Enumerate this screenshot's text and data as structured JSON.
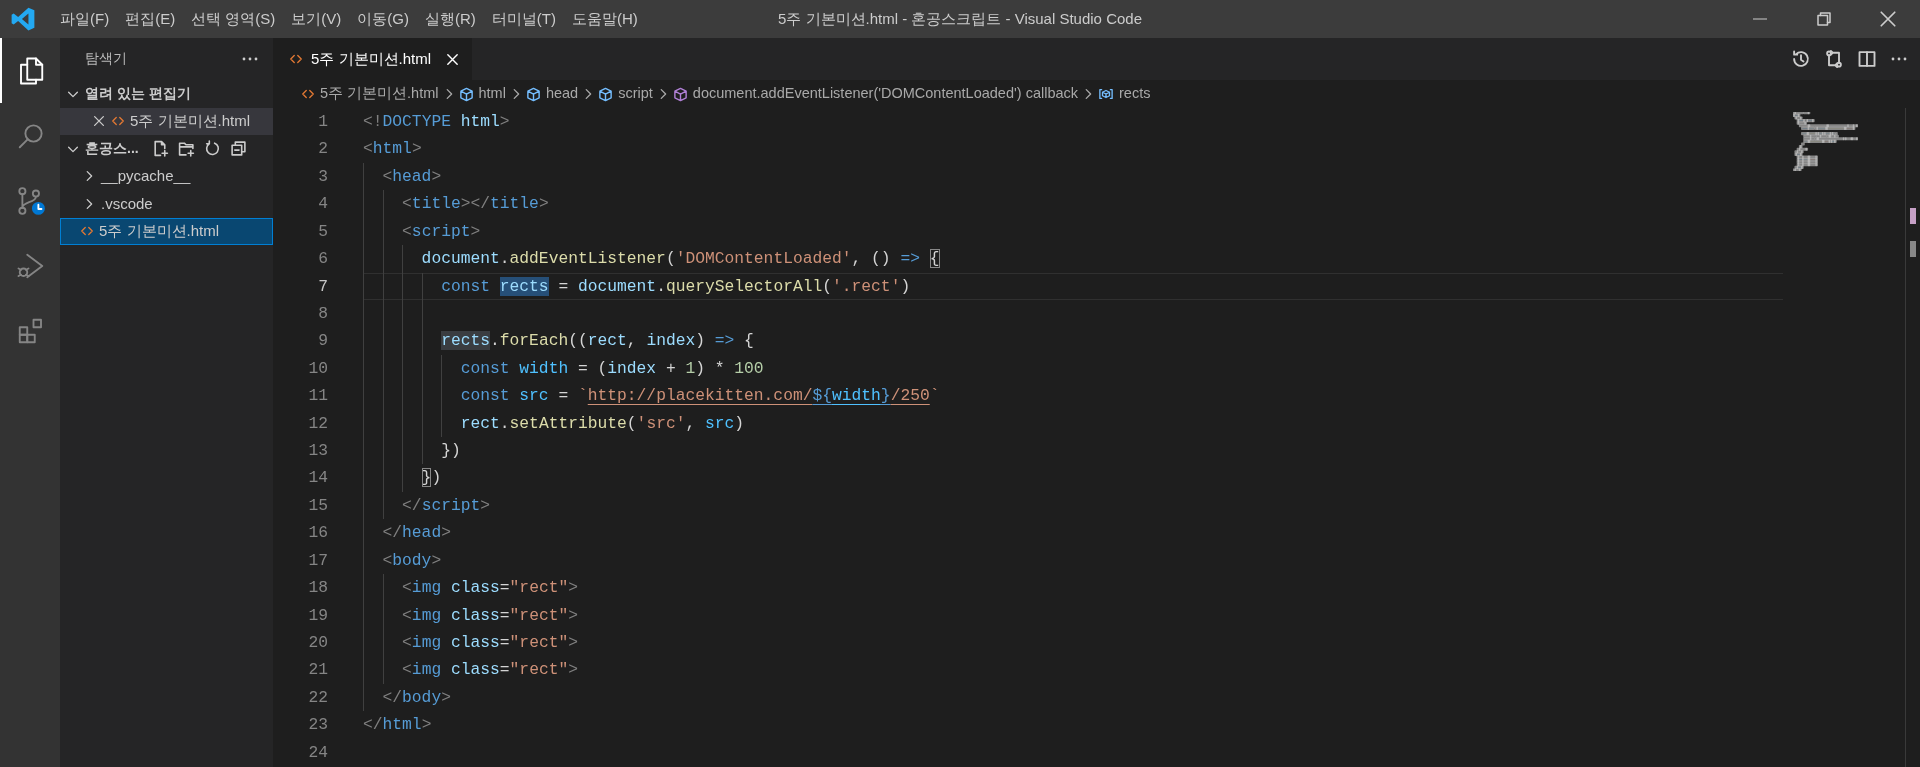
{
  "title_bar": {
    "menu": [
      "파일(F)",
      "편집(E)",
      "선택 영역(S)",
      "보기(V)",
      "이동(G)",
      "실행(R)",
      "터미널(T)",
      "도움말(H)"
    ],
    "title": "5주 기본미션.html - 혼공스크립트 - Visual Studio Code"
  },
  "activity_bar": [
    {
      "kind": "explorer",
      "selected": true
    },
    {
      "kind": "search",
      "selected": false
    },
    {
      "kind": "source_control",
      "selected": false
    },
    {
      "kind": "run",
      "selected": false
    },
    {
      "kind": "extensions",
      "selected": false
    }
  ],
  "sidebar": {
    "title": "탐색기",
    "sections": [
      {
        "kind": "open_editors",
        "title": "열려 있는 편집기",
        "expanded": true,
        "items": [
          {
            "label": "5주 기본미션.html",
            "kind": "html",
            "active": true
          }
        ]
      },
      {
        "kind": "folder",
        "title": "혼공스...",
        "expanded": true,
        "items": [
          {
            "label": "__pycache__",
            "kind": "folder",
            "expanded": false,
            "selected": false
          },
          {
            "label": ".vscode",
            "kind": "folder",
            "expanded": false,
            "selected": false
          },
          {
            "label": "5주 기본미션.html",
            "kind": "html",
            "selected": true
          }
        ]
      }
    ]
  },
  "editor": {
    "tabs": [
      {
        "label": "5주 기본미션.html",
        "selected": true
      }
    ],
    "breadcrumbs": [
      {
        "label": "5주 기본미션.html",
        "kind": "file"
      },
      {
        "label": "html",
        "kind": "element"
      },
      {
        "label": "head",
        "kind": "element"
      },
      {
        "label": "script",
        "kind": "element"
      },
      {
        "label": "document.addEventListener('DOMContentLoaded') callback",
        "kind": "function"
      },
      {
        "label": "rects",
        "kind": "variable"
      }
    ],
    "lines": [
      {
        "number": "1",
        "current": false,
        "tokens": [
          {
            "text": "<!",
            "kind": "bracket"
          },
          {
            "text": "DOCTYPE",
            "kind": "tag"
          },
          {
            "text": " html",
            "kind": "attribute"
          },
          {
            "text": ">",
            "kind": "bracket"
          }
        ]
      },
      {
        "number": "2",
        "current": false,
        "tokens": [
          {
            "text": "<",
            "kind": "bracket"
          },
          {
            "text": "html",
            "kind": "tag"
          },
          {
            "text": ">",
            "kind": "bracket"
          }
        ]
      },
      {
        "number": "3",
        "current": false,
        "tokens": [
          {
            "text": "  <",
            "kind": "bracket"
          },
          {
            "text": "head",
            "kind": "tag"
          },
          {
            "text": ">",
            "kind": "bracket"
          }
        ]
      },
      {
        "number": "4",
        "current": false,
        "tokens": [
          {
            "text": "    <",
            "kind": "bracket"
          },
          {
            "text": "title",
            "kind": "tag"
          },
          {
            "text": "></",
            "kind": "bracket"
          },
          {
            "text": "title",
            "kind": "tag"
          },
          {
            "text": ">",
            "kind": "bracket"
          }
        ]
      },
      {
        "number": "5",
        "current": false,
        "tokens": [
          {
            "text": "    <",
            "kind": "bracket"
          },
          {
            "text": "script",
            "kind": "tag"
          },
          {
            "text": ">",
            "kind": "bracket"
          }
        ]
      },
      {
        "number": "6",
        "current": false,
        "tokens": [
          {
            "text": "      document",
            "kind": "variable"
          },
          {
            "text": ".",
            "kind": "plain"
          },
          {
            "text": "addEventListener",
            "kind": "function"
          },
          {
            "text": "(",
            "kind": "plain"
          },
          {
            "text": "'DOMContentLoaded'",
            "kind": "string"
          },
          {
            "text": ", () ",
            "kind": "plain"
          },
          {
            "text": "=> ",
            "kind": "keyword"
          },
          {
            "text": "{",
            "kind": "plain",
            "bracket_match": true
          }
        ]
      },
      {
        "number": "7",
        "current": true,
        "tokens": [
          {
            "text": "        const ",
            "kind": "keyword"
          },
          {
            "text": "rects",
            "kind": "variable",
            "selected": true
          },
          {
            "text": " = ",
            "kind": "plain"
          },
          {
            "text": "document",
            "kind": "variable"
          },
          {
            "text": ".",
            "kind": "plain"
          },
          {
            "text": "querySelectorAll",
            "kind": "function"
          },
          {
            "text": "(",
            "kind": "plain"
          },
          {
            "text": "'.rect'",
            "kind": "string"
          },
          {
            "text": ")",
            "kind": "plain"
          }
        ]
      },
      {
        "number": "8",
        "current": false
      },
      {
        "number": "9",
        "current": false,
        "tokens": [
          {
            "text": "        rects",
            "kind": "variable",
            "occurrence": true
          },
          {
            "text": ".",
            "kind": "plain"
          },
          {
            "text": "forEach",
            "kind": "function"
          },
          {
            "text": "((",
            "kind": "plain"
          },
          {
            "text": "rect",
            "kind": "variable"
          },
          {
            "text": ", ",
            "kind": "plain"
          },
          {
            "text": "index",
            "kind": "variable"
          },
          {
            "text": ") ",
            "kind": "plain"
          },
          {
            "text": "=>",
            "kind": "keyword"
          },
          {
            "text": " {",
            "kind": "plain"
          }
        ]
      },
      {
        "number": "10",
        "current": false,
        "tokens": [
          {
            "text": "          const ",
            "kind": "keyword"
          },
          {
            "text": "width",
            "kind": "constant"
          },
          {
            "text": " = (",
            "kind": "plain"
          },
          {
            "text": "index",
            "kind": "variable"
          },
          {
            "text": " + ",
            "kind": "plain"
          },
          {
            "text": "1",
            "kind": "number"
          },
          {
            "text": ") * ",
            "kind": "plain"
          },
          {
            "text": "100",
            "kind": "number"
          }
        ]
      },
      {
        "number": "11",
        "current": false,
        "tokens": [
          {
            "text": "          const ",
            "kind": "keyword"
          },
          {
            "text": "src",
            "kind": "constant"
          },
          {
            "text": " = ",
            "kind": "plain"
          },
          {
            "text": "`",
            "kind": "string"
          },
          {
            "text": "http://placekitten.com/",
            "kind": "string",
            "link": true
          },
          {
            "text": "${",
            "kind": "keyword",
            "link": true
          },
          {
            "text": "width",
            "kind": "constant",
            "link": true
          },
          {
            "text": "}",
            "kind": "keyword",
            "link": true
          },
          {
            "text": "/250",
            "kind": "string",
            "link": true
          },
          {
            "text": "`",
            "kind": "string"
          }
        ]
      },
      {
        "number": "12",
        "current": false,
        "tokens": [
          {
            "text": "          rect",
            "kind": "variable"
          },
          {
            "text": ".",
            "kind": "plain"
          },
          {
            "text": "setAttribute",
            "kind": "function"
          },
          {
            "text": "(",
            "kind": "plain"
          },
          {
            "text": "'src'",
            "kind": "string"
          },
          {
            "text": ", ",
            "kind": "plain"
          },
          {
            "text": "src",
            "kind": "constant"
          },
          {
            "text": ")",
            "kind": "plain"
          }
        ]
      },
      {
        "number": "13",
        "current": false,
        "tokens": [
          {
            "text": "        })",
            "kind": "plain"
          }
        ]
      },
      {
        "number": "14",
        "current": false,
        "tokens": [
          {
            "text": "      }",
            "kind": "plain",
            "bracket_match": true
          },
          {
            "text": ")",
            "kind": "plain"
          }
        ]
      },
      {
        "number": "15",
        "current": false,
        "tokens": [
          {
            "text": "    </",
            "kind": "bracket"
          },
          {
            "text": "script",
            "kind": "tag"
          },
          {
            "text": ">",
            "kind": "bracket"
          }
        ]
      },
      {
        "number": "16",
        "current": false,
        "tokens": [
          {
            "text": "  </",
            "kind": "bracket"
          },
          {
            "text": "head",
            "kind": "tag"
          },
          {
            "text": ">",
            "kind": "bracket"
          }
        ]
      },
      {
        "number": "17",
        "current": false,
        "tokens": [
          {
            "text": "  <",
            "kind": "bracket"
          },
          {
            "text": "body",
            "kind": "tag"
          },
          {
            "text": ">",
            "kind": "bracket"
          }
        ]
      },
      {
        "number": "18",
        "current": false,
        "tokens": [
          {
            "text": "    <",
            "kind": "bracket"
          },
          {
            "text": "img ",
            "kind": "tag"
          },
          {
            "text": "class",
            "kind": "attribute"
          },
          {
            "text": "=",
            "kind": "plain"
          },
          {
            "text": "\"rect\"",
            "kind": "string"
          },
          {
            "text": ">",
            "kind": "bracket"
          }
        ]
      },
      {
        "number": "19",
        "current": false,
        "tokens": [
          {
            "text": "    <",
            "kind": "bracket"
          },
          {
            "text": "img ",
            "kind": "tag"
          },
          {
            "text": "class",
            "kind": "attribute"
          },
          {
            "text": "=",
            "kind": "plain"
          },
          {
            "text": "\"rect\"",
            "kind": "string"
          },
          {
            "text": ">",
            "kind": "bracket"
          }
        ]
      },
      {
        "number": "20",
        "current": false,
        "tokens": [
          {
            "text": "    <",
            "kind": "bracket"
          },
          {
            "text": "img ",
            "kind": "tag"
          },
          {
            "text": "class",
            "kind": "attribute"
          },
          {
            "text": "=",
            "kind": "plain"
          },
          {
            "text": "\"rect\"",
            "kind": "string"
          },
          {
            "text": ">",
            "kind": "bracket"
          }
        ]
      },
      {
        "number": "21",
        "current": false,
        "tokens": [
          {
            "text": "    <",
            "kind": "bracket"
          },
          {
            "text": "img ",
            "kind": "tag"
          },
          {
            "text": "class",
            "kind": "attribute"
          },
          {
            "text": "=",
            "kind": "plain"
          },
          {
            "text": "\"rect\"",
            "kind": "string"
          },
          {
            "text": ">",
            "kind": "bracket"
          }
        ]
      },
      {
        "number": "22",
        "current": false,
        "tokens": [
          {
            "text": "  </",
            "kind": "bracket"
          },
          {
            "text": "body",
            "kind": "tag"
          },
          {
            "text": ">",
            "kind": "bracket"
          }
        ]
      },
      {
        "number": "23",
        "current": false,
        "tokens": [
          {
            "text": "</",
            "kind": "bracket"
          },
          {
            "text": "html",
            "kind": "tag"
          },
          {
            "text": ">",
            "kind": "bracket"
          }
        ]
      },
      {
        "number": "24",
        "current": false
      }
    ]
  }
}
